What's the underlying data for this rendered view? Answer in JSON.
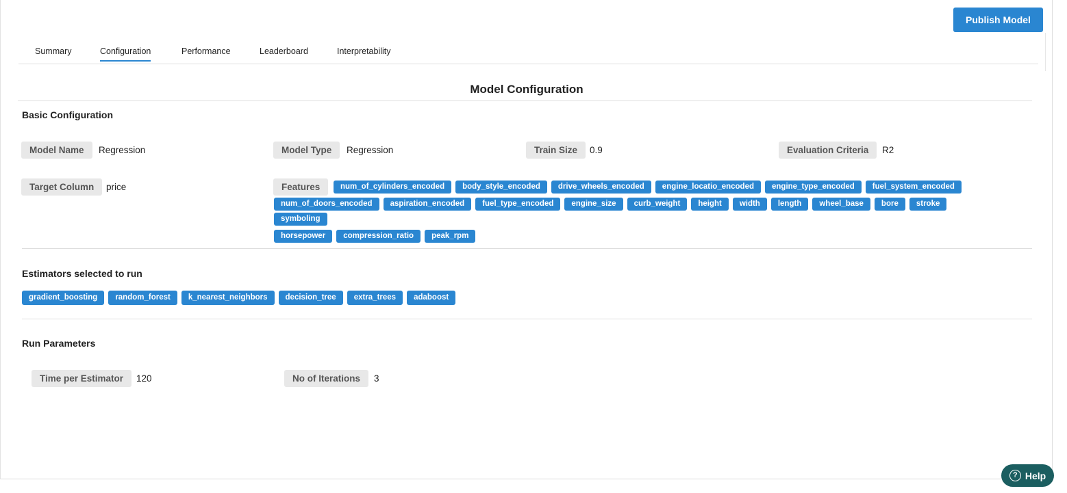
{
  "header": {
    "publish_label": "Publish Model"
  },
  "tabs": [
    {
      "label": "Summary",
      "active": false
    },
    {
      "label": "Configuration",
      "active": true
    },
    {
      "label": "Performance",
      "active": false
    },
    {
      "label": "Leaderboard",
      "active": false
    },
    {
      "label": "Interpretability",
      "active": false
    }
  ],
  "page_title": "Model Configuration",
  "basic": {
    "title": "Basic Configuration",
    "model_name": {
      "label": "Model Name",
      "value": "Regression"
    },
    "model_type": {
      "label": "Model Type",
      "value": "Regression"
    },
    "train_size": {
      "label": "Train Size",
      "value": "0.9"
    },
    "evaluation": {
      "label": "Evaluation Criteria",
      "value": "R2"
    },
    "target": {
      "label": "Target Column",
      "value": "price"
    },
    "features_label": "Features",
    "features": [
      "num_of_cylinders_encoded",
      "body_style_encoded",
      "drive_wheels_encoded",
      "engine_locatio_encoded",
      "engine_type_encoded",
      "fuel_system_encoded",
      "num_of_doors_encoded",
      "aspiration_encoded",
      "fuel_type_encoded",
      "engine_size",
      "curb_weight",
      "height",
      "width",
      "length",
      "wheel_base",
      "bore",
      "stroke",
      "symboling",
      "horsepower",
      "compression_ratio",
      "peak_rpm"
    ]
  },
  "estimators": {
    "title": "Estimators selected to run",
    "items": [
      "gradient_boosting",
      "random_forest",
      "k_nearest_neighbors",
      "decision_tree",
      "extra_trees",
      "adaboost"
    ]
  },
  "run_params": {
    "title": "Run Parameters",
    "time_per_estimator": {
      "label": "Time per Estimator",
      "value": "120"
    },
    "iterations": {
      "label": "No of Iterations",
      "value": "3"
    }
  },
  "help": {
    "label": "Help",
    "icon": "question-circle-icon"
  },
  "colors": {
    "accent": "#2a86d1",
    "help_bg": "#1b5e60",
    "label_bg": "#e8e8e8"
  }
}
